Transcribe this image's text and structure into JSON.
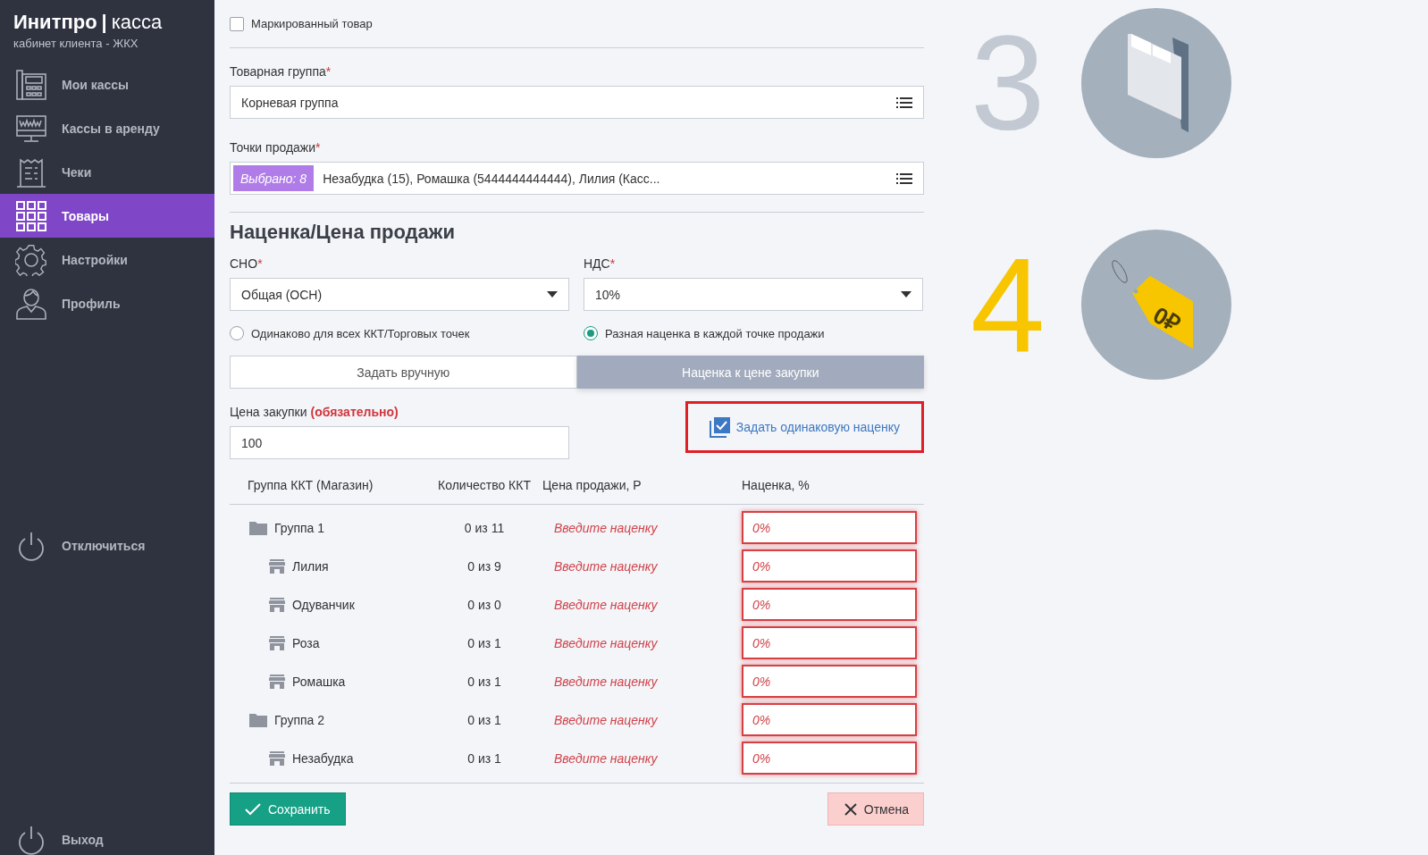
{
  "brand": {
    "name": "Инитпро",
    "separator": "|",
    "product": "касса",
    "subtitle": "кабинет клиента - ЖКХ"
  },
  "sidebar": {
    "items": [
      {
        "label": "Мои кассы",
        "kind": "register",
        "selected": false
      },
      {
        "label": "Кассы в аренду",
        "kind": "monitor",
        "selected": false
      },
      {
        "label": "Чеки",
        "kind": "receipt",
        "selected": false
      },
      {
        "label": "Товары",
        "kind": "grid",
        "selected": true
      },
      {
        "label": "Настройки",
        "kind": "gear",
        "selected": false
      },
      {
        "label": "Профиль",
        "kind": "person",
        "selected": false
      }
    ],
    "footer": [
      {
        "label": "Отключиться",
        "kind": "power"
      },
      {
        "label": "Выход",
        "kind": "power"
      }
    ]
  },
  "form": {
    "marked": {
      "label": "Маркированный товар",
      "checked": false
    },
    "product_group": {
      "label": "Товарная группа",
      "required_mark": "*",
      "value": "Корневая группа"
    },
    "sale_points": {
      "label": "Точки продажи",
      "required_mark": "*",
      "badge": "Выбрано: 8",
      "value": "Незабудка (15), Ромашка (5444444444444), Лилия (Касс..."
    },
    "section_title": "Наценка/Цена продажи",
    "sno": {
      "label": "СНО",
      "required_mark": "*",
      "value": "Общая (ОСН)"
    },
    "vat": {
      "label": "НДС",
      "required_mark": "*",
      "value": "10%"
    },
    "radios": [
      {
        "label": "Одинаково для всех ККТ/Торговых точек",
        "selected": false
      },
      {
        "label": "Разная наценка в каждой точке продажи",
        "selected": true
      }
    ],
    "mode_tabs": [
      {
        "label": "Задать вручную",
        "selected": false
      },
      {
        "label": "Наценка к цене закупки",
        "selected": true
      }
    ],
    "purchase_price": {
      "label": "Цена закупки",
      "note": "(обязательно)",
      "value": "100"
    },
    "same_markup": {
      "label": "Задать одинаковую наценку",
      "checked": true,
      "highlighted": true
    },
    "table": {
      "columns": [
        "Группа ККТ (Магазин)",
        "Количество ККТ",
        "Цена продажи, Р",
        "Наценка, %"
      ],
      "rows": [
        {
          "kind": "group",
          "name": "Группа 1",
          "count": "0 из 11",
          "price": "Введите наценку",
          "markup_placeholder": "0%",
          "invalid": true,
          "children": [
            {
              "kind": "store",
              "name": "Лилия",
              "count": "0 из 9",
              "price": "Введите наценку",
              "markup_placeholder": "0%",
              "invalid": true
            },
            {
              "kind": "store",
              "name": "Одуванчик",
              "count": "0 из 0",
              "price": "Введите наценку",
              "markup_placeholder": "0%",
              "invalid": true
            },
            {
              "kind": "store",
              "name": "Роза",
              "count": "0 из 1",
              "price": "Введите наценку",
              "markup_placeholder": "0%",
              "invalid": true
            },
            {
              "kind": "store",
              "name": "Ромашка",
              "count": "0 из 1",
              "price": "Введите наценку",
              "markup_placeholder": "0%",
              "invalid": true
            }
          ]
        },
        {
          "kind": "group",
          "name": "Группа 2",
          "count": "0 из 1",
          "price": "Введите наценку",
          "markup_placeholder": "0%",
          "invalid": true,
          "children": [
            {
              "kind": "store",
              "name": "Незабудка",
              "count": "0 из 1",
              "price": "Введите наценку",
              "markup_placeholder": "0%",
              "invalid": true
            }
          ]
        }
      ]
    },
    "save_button": "Сохранить",
    "cancel_button": "Отмена"
  },
  "steps": [
    {
      "number": "3",
      "kind": "folder",
      "active": false
    },
    {
      "number": "4",
      "kind": "tag",
      "tag_text": "0₽",
      "active": true
    }
  ]
}
